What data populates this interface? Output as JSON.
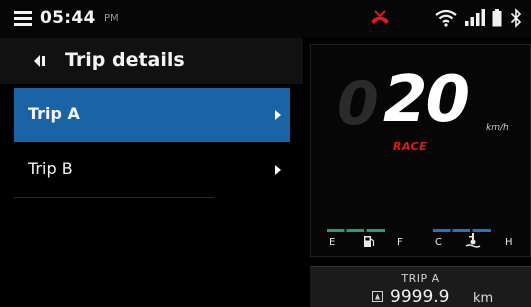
{
  "status_bar": {
    "time": "05:44",
    "ampm": "PM",
    "icons": [
      "menu-icon",
      "missed-call-icon",
      "wifi-icon",
      "signal-icon",
      "battery-icon",
      "bluetooth-icon"
    ],
    "colors": {
      "call_icon": "#e0191f"
    }
  },
  "trip_menu": {
    "back_icon": "back-arrow-icon",
    "title": "Trip details",
    "items": [
      {
        "label": "Trip A",
        "selected": true
      },
      {
        "label": "Trip B",
        "selected": false
      }
    ],
    "colors": {
      "selected_bg": "#1a63a4"
    }
  },
  "speedometer": {
    "ghost_digits": "0",
    "speed": "20",
    "unit": "km/h",
    "mode": "RACE",
    "colors": {
      "mode": "#e0191f"
    }
  },
  "gauges": {
    "fuel": {
      "empty_label": "E",
      "full_label": "F",
      "icon": "fuel-pump-icon",
      "color": "#1fa36e"
    },
    "temperature": {
      "cold_label": "C",
      "hot_label": "H",
      "icon": "coolant-temp-icon",
      "color": "#1d74c9"
    }
  },
  "trip_box": {
    "title": "TRIP A",
    "icon": "odometer-icon",
    "value": "9999.9",
    "unit": "km"
  }
}
